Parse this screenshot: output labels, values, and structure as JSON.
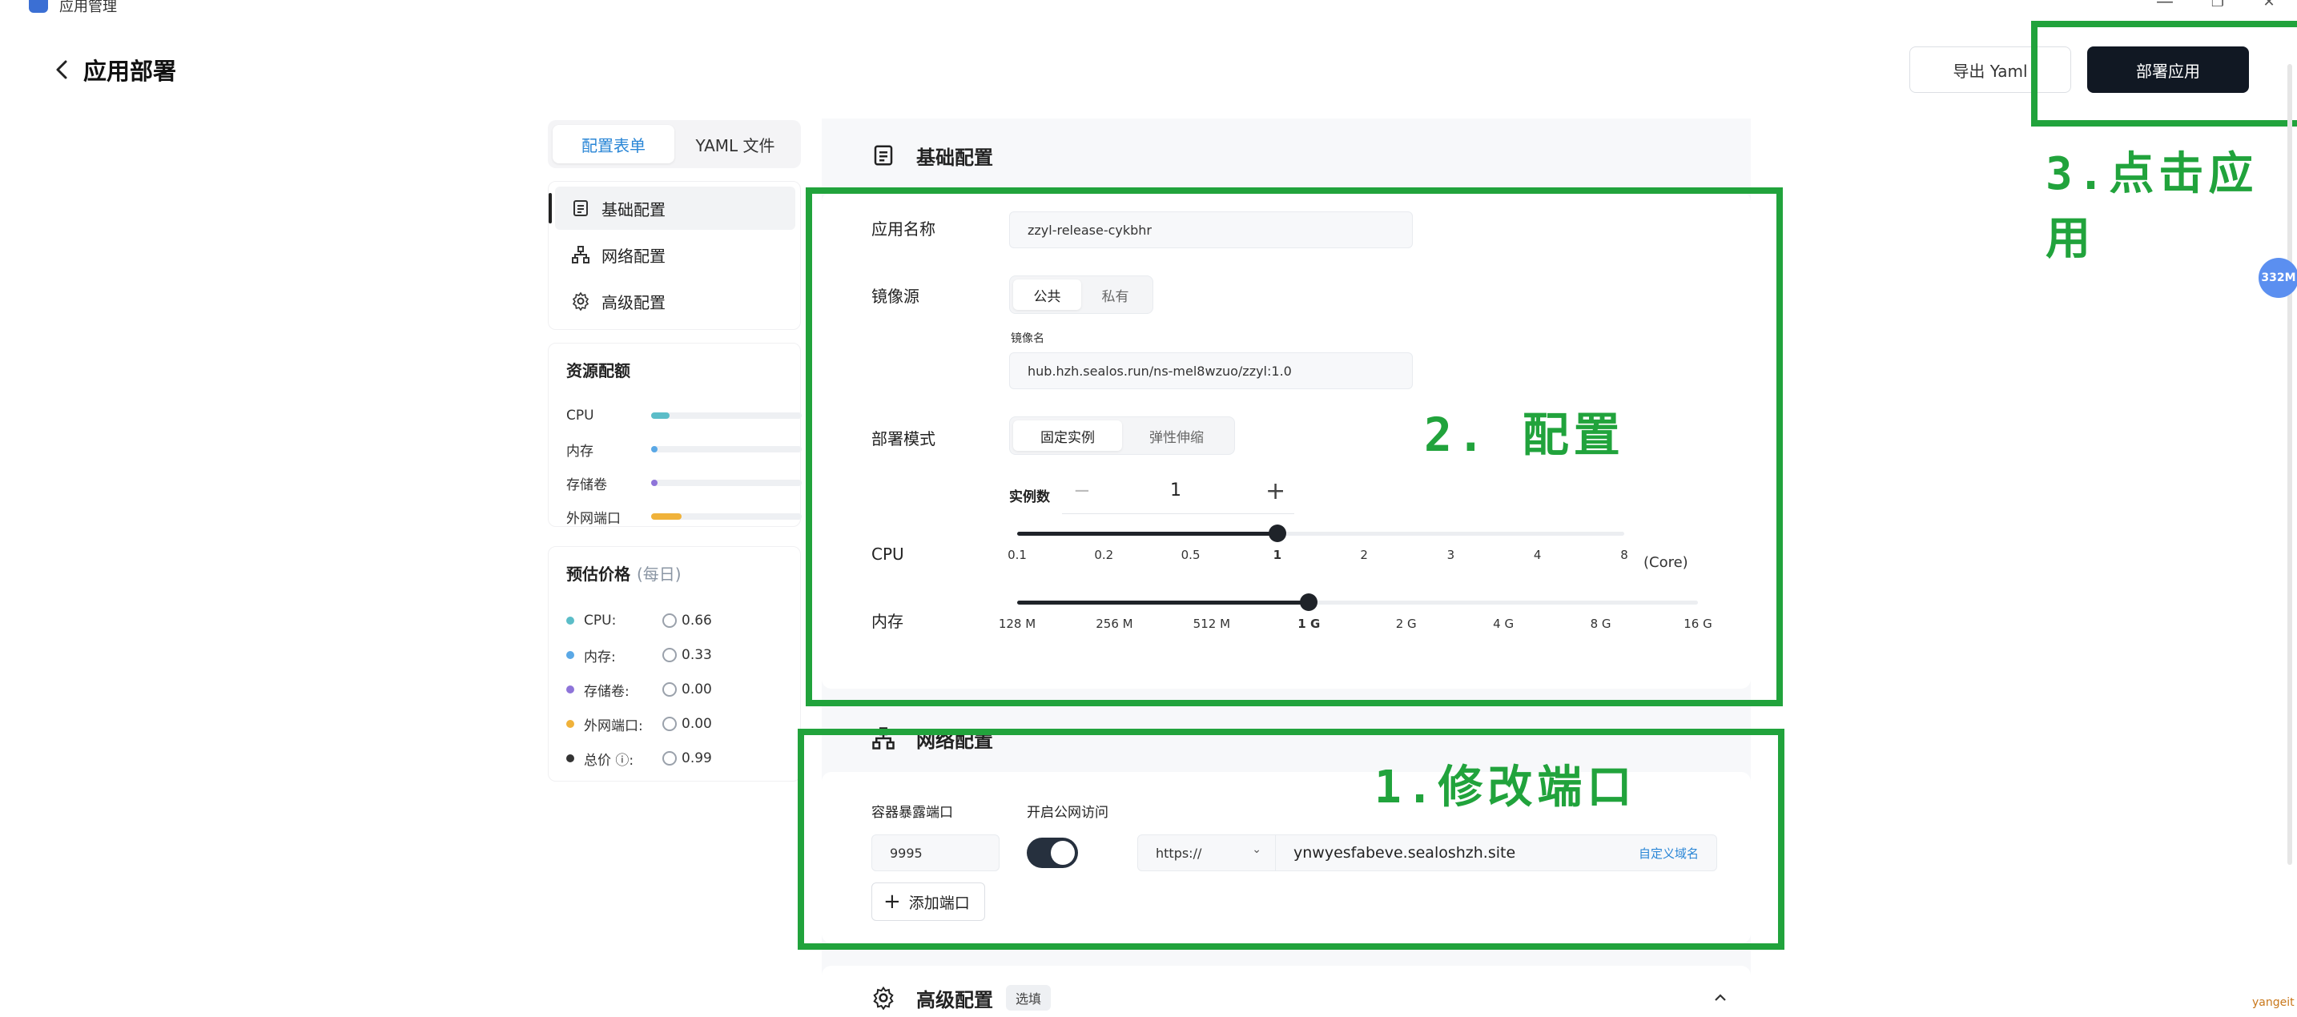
{
  "window": {
    "title": "应用管理",
    "controls": [
      "—",
      "❐",
      "✕"
    ]
  },
  "header": {
    "title": "应用部署",
    "export_label": "导出 Yaml",
    "deploy_label": "部署应用"
  },
  "tabs": [
    {
      "label": "配置表单",
      "active": true
    },
    {
      "label": "YAML 文件",
      "active": false
    }
  ],
  "nav": [
    {
      "label": "基础配置",
      "icon": "document-icon",
      "active": true
    },
    {
      "label": "网络配置",
      "icon": "network-icon",
      "active": false
    },
    {
      "label": "高级配置",
      "icon": "gear-icon",
      "active": false
    }
  ],
  "resources": {
    "title": "资源配额",
    "items": [
      {
        "label": "CPU",
        "color": "#5bbdc8",
        "fraction": 0.12
      },
      {
        "label": "内存",
        "color": "#5aa8e6",
        "fraction": 0.04
      },
      {
        "label": "存储卷",
        "color": "#8e74d9",
        "fraction": 0.02
      },
      {
        "label": "外网端口",
        "color": "#f0b23a",
        "fraction": 0.2
      }
    ]
  },
  "price": {
    "title": "预估价格",
    "subtitle": "(每日)",
    "items": [
      {
        "label": "CPU:",
        "value": "0.66",
        "color": "#5bbdc8"
      },
      {
        "label": "内存:",
        "value": "0.33",
        "color": "#5aa8e6"
      },
      {
        "label": "存储卷:",
        "value": "0.00",
        "color": "#8e74d9"
      },
      {
        "label": "外网端口:",
        "value": "0.00",
        "color": "#f0b23a"
      },
      {
        "label": "总价 ⓘ:",
        "value": "0.99",
        "color": "#333333"
      }
    ]
  },
  "basic": {
    "title": "基础配置",
    "app_name_label": "应用名称",
    "app_name_value": "zzyl-release-cykbhr",
    "image_source_label": "镜像源",
    "image_source_options": [
      "公共",
      "私有"
    ],
    "image_source_selected": "公共",
    "image_name_label": "镜像名",
    "image_name_value": "hub.hzh.sealos.run/ns-mel8wzuo/zzyl:1.0",
    "deploy_mode_label": "部署模式",
    "deploy_mode_options": [
      "固定实例",
      "弹性伸缩"
    ],
    "deploy_mode_selected": "固定实例",
    "instances_label": "实例数",
    "instances_value": "1",
    "cpu_label": "CPU",
    "cpu_unit": "(Core)",
    "cpu_ticks": [
      "0.1",
      "0.2",
      "0.5",
      "1",
      "2",
      "3",
      "4",
      "8"
    ],
    "cpu_selected": "1",
    "mem_label": "内存",
    "mem_ticks": [
      "128 M",
      "256 M",
      "512 M",
      "1 G",
      "2 G",
      "4 G",
      "8 G",
      "16 G"
    ],
    "mem_selected": "1 G"
  },
  "network": {
    "title": "网络配置",
    "port_label": "容器暴露端口",
    "public_label": "开启公网访问",
    "port_value": "9995",
    "public_enabled": true,
    "protocol": "https://",
    "domain": "ynwyesfabeve.sealoshzh.site",
    "custom_domain": "自定义域名",
    "add_port": "添加端口"
  },
  "advanced": {
    "title": "高级配置",
    "badge": "选填"
  },
  "annotations": {
    "step1": "1.修改端口",
    "step2": "2. 配置",
    "step3": "3.点击应用"
  },
  "badges": {
    "memory": "332M",
    "watermark": "yangeit"
  },
  "colors": {
    "accent": "#2a86d6",
    "annotation": "#21a33c",
    "primary_button": "#111823"
  }
}
